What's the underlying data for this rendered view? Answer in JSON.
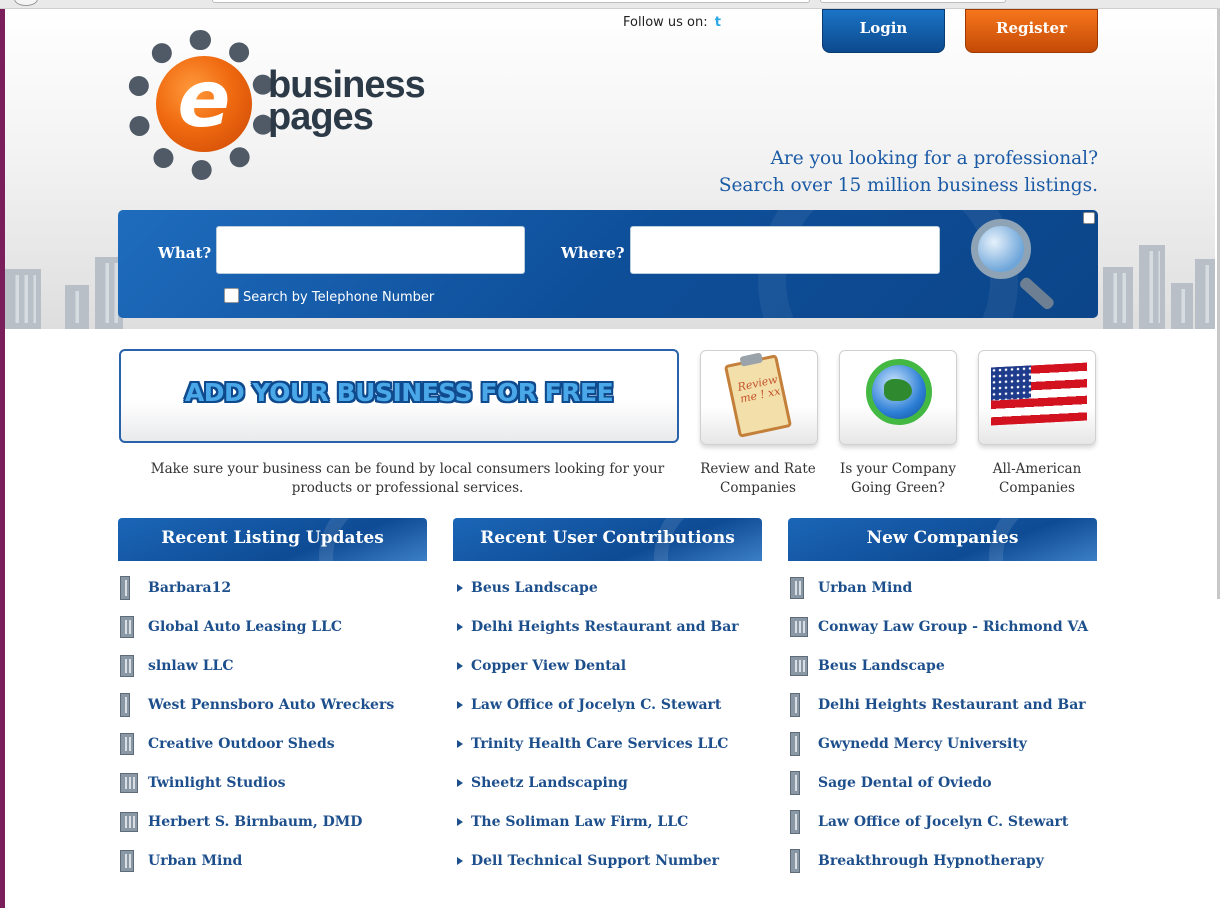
{
  "header": {
    "logo_line1": "business",
    "logo_line2": "pages",
    "logo_letter": "e",
    "follow_label": "Follow us on:",
    "twitter_icon": "t",
    "login_label": "Login",
    "register_label": "Register",
    "tagline_line1": "Are you looking for a professional?",
    "tagline_line2": "Search over 15 million business listings."
  },
  "search": {
    "what_label": "What?",
    "where_label": "Where?",
    "what_value": "",
    "where_value": "",
    "telephone_label": "Search by Telephone Number",
    "telephone_checked": false
  },
  "promo": {
    "add_business_label": "ADD YOUR BUSINESS FOR FREE",
    "add_business_desc": "Make sure your business can be found by local consumers looking for your products or professional services.",
    "review_icon_text": "Review me ! xx",
    "tiles": [
      {
        "icon": "review-clipboard-icon",
        "caption": "Review and Rate Companies"
      },
      {
        "icon": "recycle-globe-icon",
        "caption": "Is your Company Going Green?"
      },
      {
        "icon": "american-flag-icon",
        "caption": "All-American Companies"
      }
    ]
  },
  "columns": [
    {
      "title": "Recent Listing Updates",
      "items": [
        "Barbara12",
        "Global Auto Leasing LLC",
        "slnlaw LLC",
        "West Pennsboro Auto Wreckers",
        "Creative Outdoor Sheds",
        "Twinlight Studios",
        "Herbert S. Birnbaum, DMD",
        "Urban Mind"
      ]
    },
    {
      "title": "Recent User Contributions",
      "items": [
        "Beus Landscape",
        "Delhi Heights Restaurant and Bar",
        "Copper View Dental",
        "Law Office of Jocelyn C. Stewart",
        "Trinity Health Care Services LLC",
        "Sheetz Landscaping",
        "The Soliman Law Firm, LLC",
        "Dell Technical Support Number"
      ]
    },
    {
      "title": "New Companies",
      "items": [
        "Urban Mind",
        "Conway Law Group - Richmond VA",
        "Beus Landscape",
        "Delhi Heights Restaurant and Bar",
        "Gwynedd Mercy University",
        "Sage Dental of Oviedo",
        "Law Office of Jocelyn C. Stewart",
        "Breakthrough Hypnotherapy"
      ]
    }
  ],
  "colors": {
    "brand_blue": "#0e4f9a",
    "brand_orange": "#f06a10",
    "link_blue": "#1d4f8c"
  }
}
